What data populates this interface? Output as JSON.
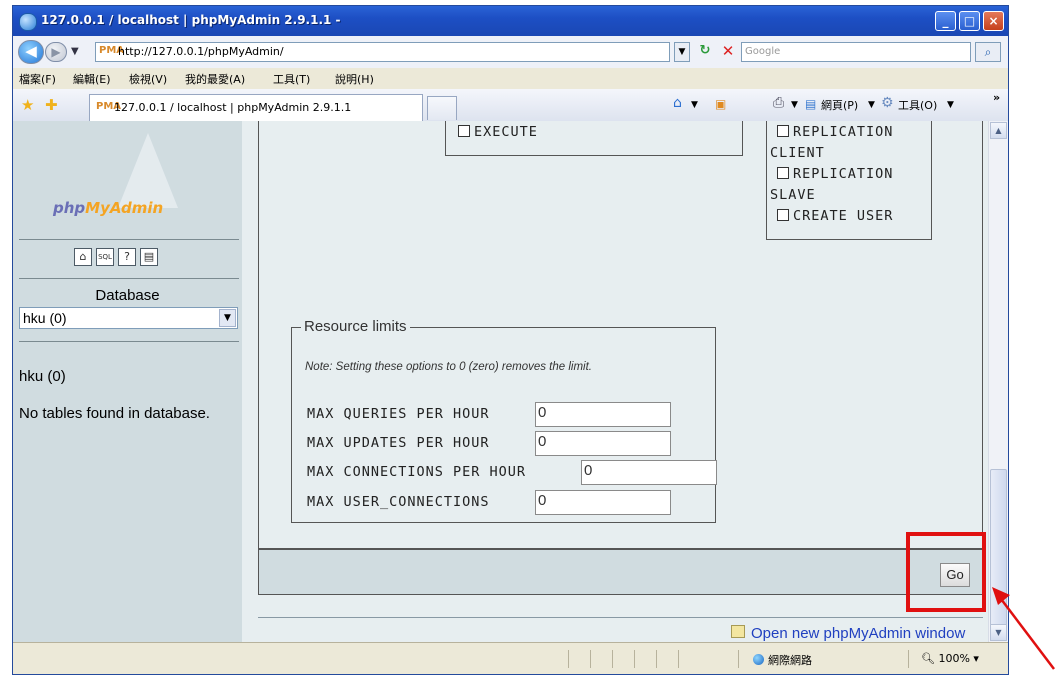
{
  "window": {
    "title": "127.0.0.1 / localhost | phpMyAdmin 2.9.1.1 -",
    "btn_minimize": "_",
    "btn_maximize": "□",
    "btn_close": "×"
  },
  "address_bar": {
    "url": "http://127.0.0.1/phpMyAdmin/",
    "url_favicon": "PMA",
    "search_placeholder": "Google",
    "back_icon": "◀",
    "forward_icon": "▶",
    "dropdown_icon": "▼",
    "refresh_icon": "↻",
    "stop_icon": "✕",
    "search_icon": "⌕"
  },
  "menu": {
    "items": [
      "檔案(F)",
      "編輯(E)",
      "檢視(V)",
      "我的最愛(A)",
      "工具(T)",
      "說明(H)"
    ]
  },
  "tabbar": {
    "active_tab_title": "127.0.0.1 / localhost | phpMyAdmin 2.9.1.1",
    "tab_favicon": "PMA",
    "page_label": "網頁(P)",
    "tools_label": "工具(O)",
    "overflow_icon": "»"
  },
  "left_frame": {
    "logo_part1": "php",
    "logo_part2": "MyAdmin",
    "nav_icons": [
      "home-icon",
      "sql-query-icon",
      "docs-icon",
      "docs-alt-icon"
    ],
    "database_label": "Database",
    "database_selected": "hku (0)",
    "current_db": "hku (0)",
    "no_tables_text": "No tables found in database."
  },
  "privileges": {
    "box1": [
      "EXECUTE"
    ],
    "box2_line1": "REPLICATION",
    "box2_line2": "CLIENT",
    "box2_line3": "REPLICATION",
    "box2_line4": "SLAVE",
    "box2_line5": "CREATE USER"
  },
  "resource_limits": {
    "legend": "Resource limits",
    "note": "Note: Setting these options to 0 (zero) removes the limit.",
    "rows": [
      {
        "label": "MAX QUERIES PER HOUR",
        "value": "0"
      },
      {
        "label": "MAX UPDATES PER HOUR",
        "value": "0"
      },
      {
        "label": "MAX CONNECTIONS PER HOUR",
        "value": "0"
      },
      {
        "label": "MAX USER_CONNECTIONS",
        "value": "0"
      }
    ]
  },
  "actions": {
    "go_label": "Go",
    "open_new_window": "Open new phpMyAdmin window"
  },
  "status_bar": {
    "zone": "網際網路",
    "zoom": "100%"
  },
  "colors": {
    "title_bar": "#1d4fc4",
    "left_frame_bg": "#d0dce0",
    "right_frame_bg": "#e7eef0",
    "highlight": "#e01010"
  }
}
